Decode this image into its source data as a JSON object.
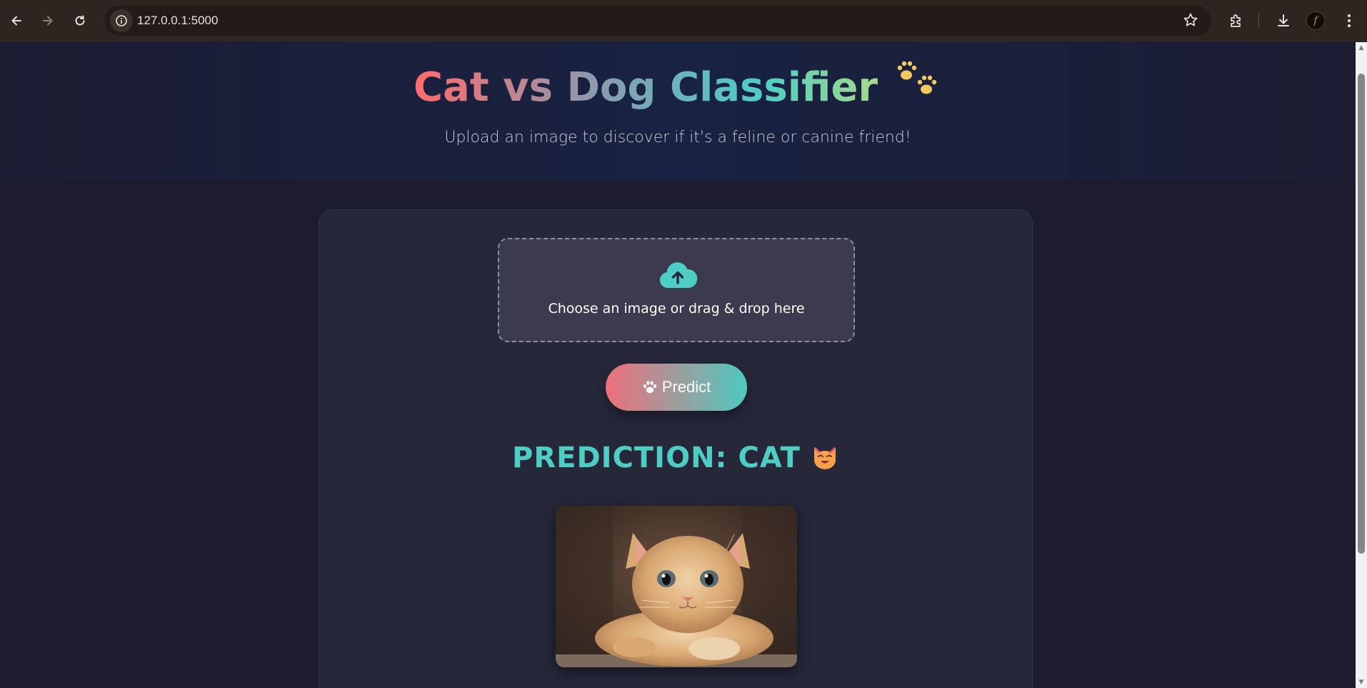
{
  "browser": {
    "url": "127.0.0.1:5000"
  },
  "header": {
    "title": "Cat vs Dog Classifier",
    "title_emoji": "🐾",
    "subtitle": "Upload an image to discover if it's a feline or canine friend!"
  },
  "upload": {
    "label": "Choose an image or drag & drop here"
  },
  "predict_button": {
    "label": "Predict"
  },
  "result": {
    "prediction_text": "PREDICTION: CAT",
    "prediction_emoji": "😺"
  },
  "colors": {
    "accent_teal": "#4ecdc4",
    "accent_coral": "#ff6b6b",
    "background": "#1c1c2e",
    "card": "#262739"
  }
}
